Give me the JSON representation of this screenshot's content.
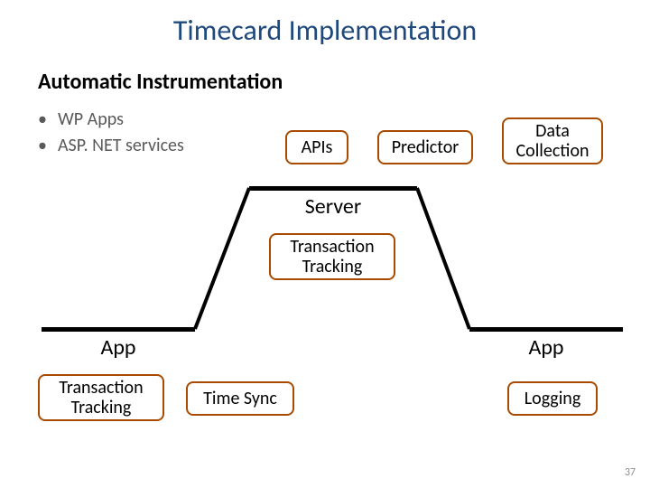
{
  "title": "Timecard Implementation",
  "subhead": "Automatic Instrumentation",
  "bullets": [
    "WP Apps",
    "ASP. NET services"
  ],
  "platforms": {
    "server": "Server",
    "app_left": "App",
    "app_right": "App"
  },
  "boxes": {
    "apis": "APIs",
    "predictor": "Predictor",
    "data_collection": "Data\nCollection",
    "transaction_tracking_server": "Transaction\nTracking",
    "transaction_tracking_app": "Transaction\nTracking",
    "time_sync": "Time Sync",
    "logging": "Logging"
  },
  "page_number": "37"
}
